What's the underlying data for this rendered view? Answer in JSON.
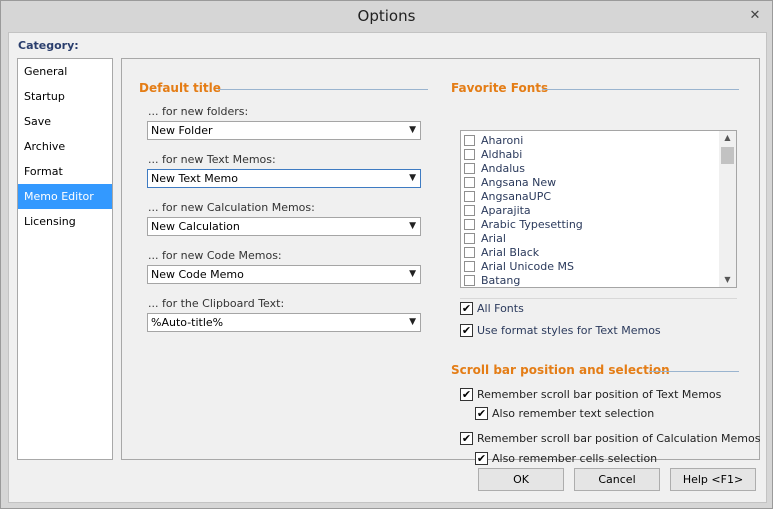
{
  "window": {
    "title": "Options",
    "close_glyph": "✕"
  },
  "category": {
    "label": "Category:",
    "items": [
      "General",
      "Startup",
      "Save",
      "Archive",
      "Format",
      "Memo Editor",
      "Licensing"
    ],
    "selected": "Memo Editor"
  },
  "default_title": {
    "heading": "Default title",
    "fields": [
      {
        "label": "... for new folders:",
        "value": "New Folder"
      },
      {
        "label": "... for new Text Memos:",
        "value": "New Text Memo"
      },
      {
        "label": "... for new Calculation Memos:",
        "value": "New Calculation"
      },
      {
        "label": "... for new Code Memos:",
        "value": "New Code Memo"
      },
      {
        "label": "... for the Clipboard Text:",
        "value": "%Auto-title%"
      }
    ]
  },
  "favorite_fonts": {
    "heading": "Favorite Fonts",
    "fonts": [
      "Aharoni",
      "Aldhabi",
      "Andalus",
      "Angsana New",
      "AngsanaUPC",
      "Aparajita",
      "Arabic Typesetting",
      "Arial",
      "Arial Black",
      "Arial Unicode MS",
      "Batang"
    ],
    "all_fonts": {
      "label": "All Fonts",
      "checked": true
    },
    "use_format_styles": {
      "label": "Use format styles for Text Memos",
      "checked": true
    }
  },
  "scroll_bar": {
    "heading": "Scroll bar position and selection",
    "remember_text": {
      "label": "Remember scroll bar position of Text Memos",
      "checked": true
    },
    "also_text_selection": {
      "label": "Also remember text selection",
      "checked": true
    },
    "remember_calc": {
      "label": "Remember scroll bar position of Calculation Memos",
      "checked": true
    },
    "also_cells_selection": {
      "label": "Also remember cells selection",
      "checked": true
    }
  },
  "buttons": {
    "ok": "OK",
    "cancel": "Cancel",
    "help": "Help <F1>"
  },
  "icons": {
    "dropdown": "▼",
    "check": "✔",
    "scroll_up": "▲",
    "scroll_down": "▼"
  },
  "colors": {
    "selection": "#3399ff",
    "section_heading": "#e47d16",
    "category_label": "#2a3e6d"
  }
}
